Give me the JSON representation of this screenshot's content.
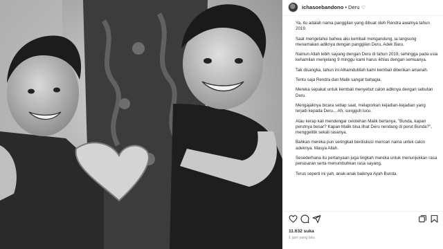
{
  "post": {
    "username": "ichasoebandono",
    "separator": "•",
    "follow_label": "Deru",
    "follow_heart": "♡",
    "caption_paragraphs": [
      "Ya, itu adalah nama panggilan yang dibuat oleh Rendra awalnya tahun 2019.",
      "Saat mengetahui bahwa aku kembali mengandung, ia langsung menamakan adiknya dengan panggilan Deru, Adek Baru.",
      "Namun Allah lebih sayang dengan Deru di tahun 2019, sehingga pada usia kehamilan menjelang 9 minggu kami harus ikhlas dengan semuanya.",
      "Tak disangka, tahun ini Alhamdulillah kami kembali diberikan amanah.",
      "Tentu saja Rendra dan Malik sangat bahagia.",
      "Mereka sepakat untuk kembali menyebut calon adiknya dengan sebutan Deru.",
      "Mengajaknya bicara setiap saat, melaporkan kejadian-kejadian yang terjadi kepada Deru... Ah, sungguh lucu.",
      "Atau kerap kali mendengar celotehan Malik bertanya, \"Bunda, kapan perutnya besar? Kapan Malik bisa lihat Deru nendang di perut Bunda?\", menggelitik sekali rasanya.",
      "Bahkan mereka pun seringkali berdiskusi mencari nama untuk calon adeknya. Masya Allah.",
      "Sesederhana itu pertanyaan juga tingkah mereka untuk menunjukkan rasa penasaran serta menumbuhkan rasa sayang.",
      "Terus seperti ini yah, anak-anak baiknya Ayah Bunda."
    ],
    "likes": "11.632 suka",
    "time": "1 jam yang lalu"
  },
  "icons": {
    "like": "heart-icon",
    "comment": "comment-icon",
    "share": "share-icon",
    "save": "bookmark-icon",
    "carousel": "carousel-icon"
  },
  "colors": {
    "text": "#262626",
    "muted": "#8e8e8e",
    "divider": "#efefef"
  }
}
